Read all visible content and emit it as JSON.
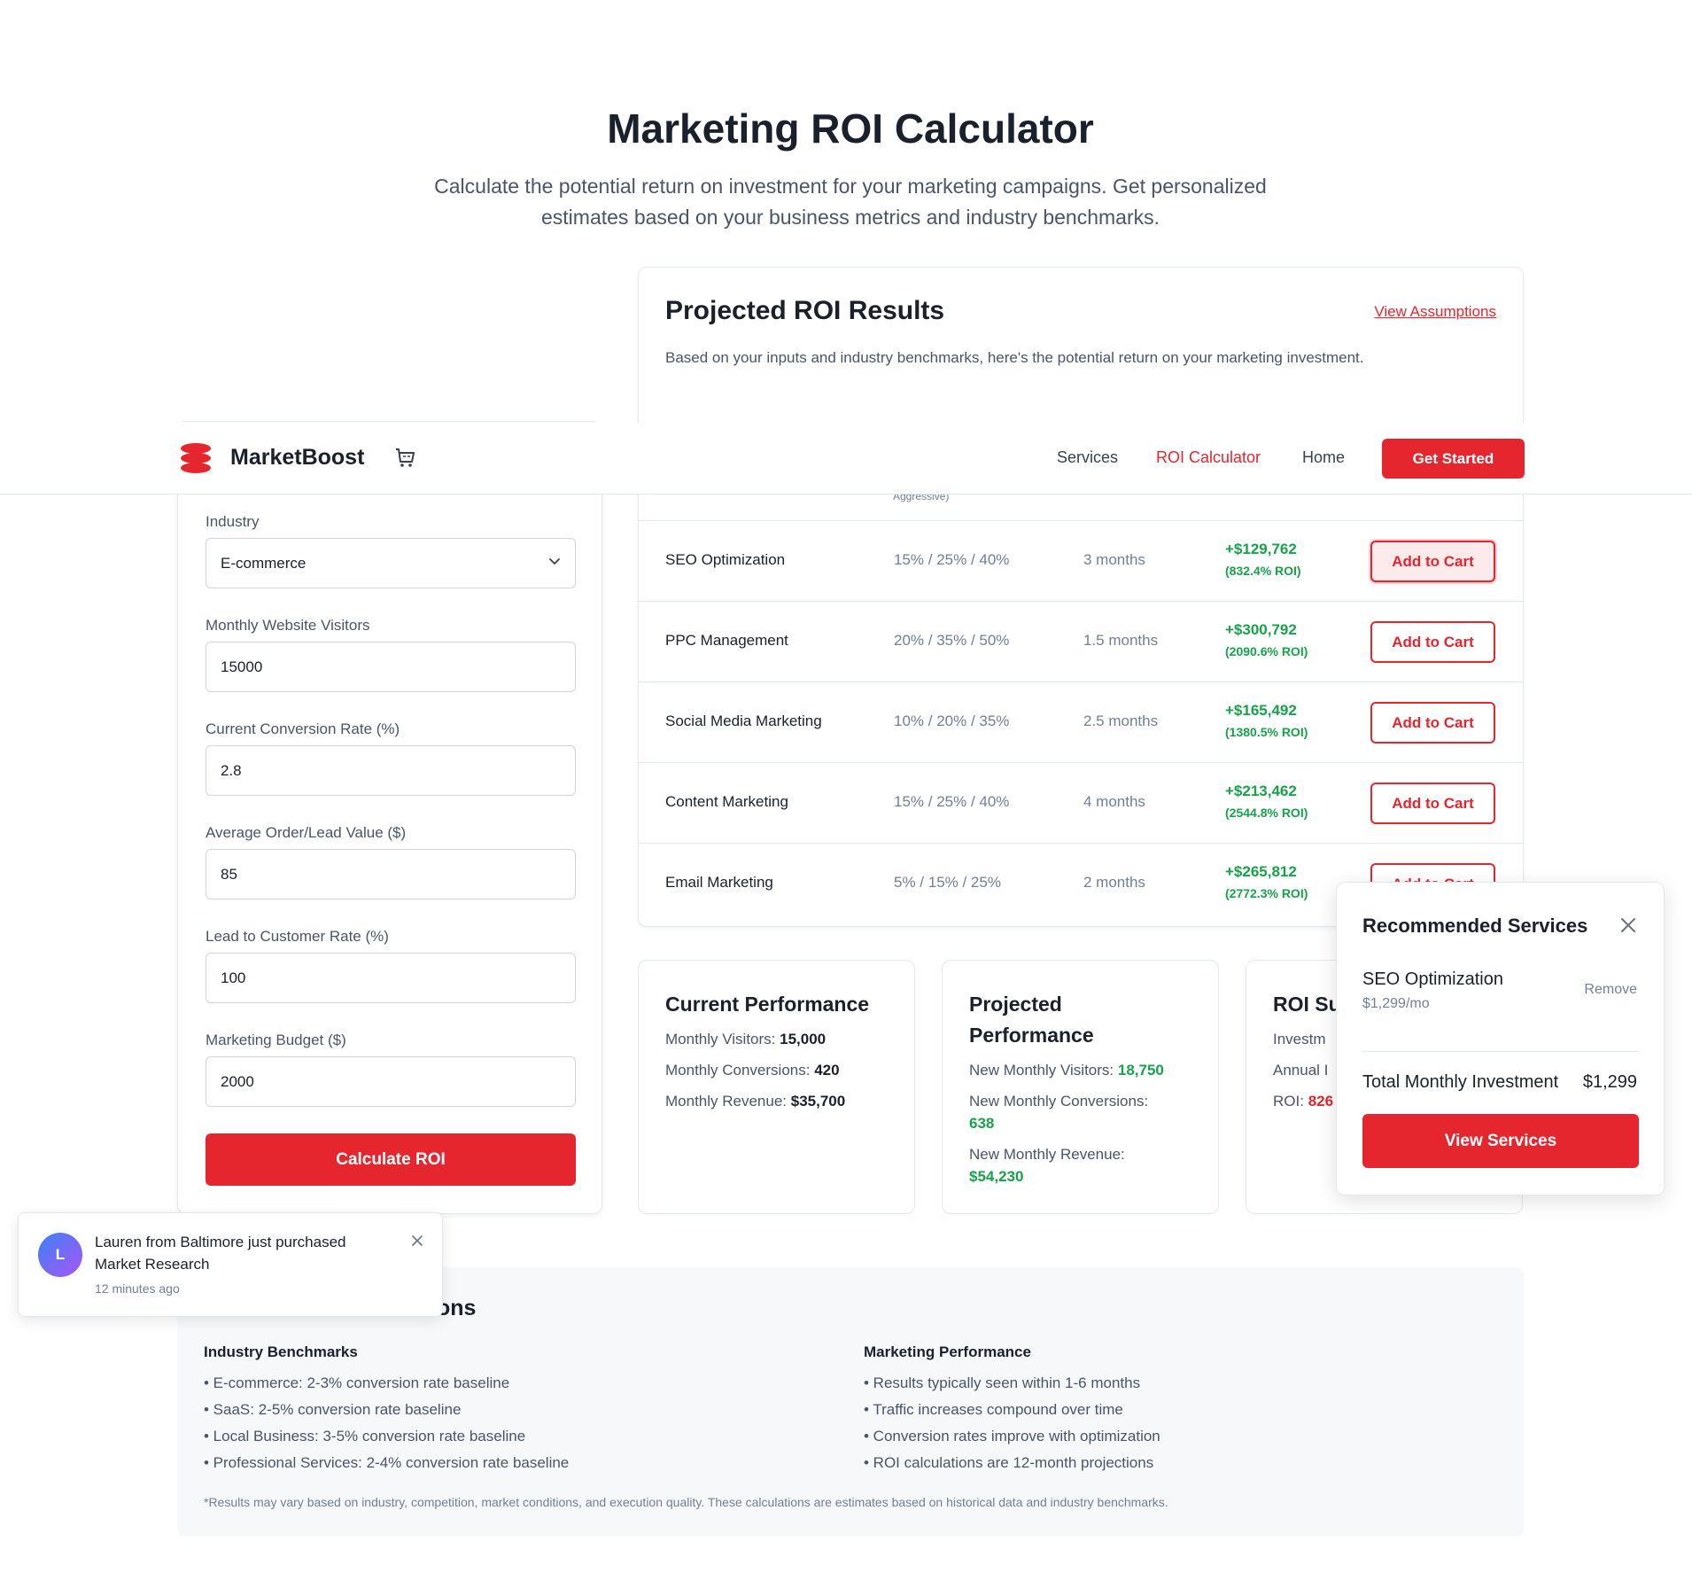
{
  "hero": {
    "title": "Marketing ROI Calculator",
    "subtitle": "Calculate the potential return on investment for your marketing campaigns. Get personalized estimates based on your business metrics and industry benchmarks."
  },
  "results": {
    "title": "Projected ROI Results",
    "view_assumptions": "View Assumptions",
    "description": "Based on your inputs and industry benchmarks, here's the potential return on your marketing investment.",
    "column_note": "Aggressive)",
    "rows": [
      {
        "name": "SEO Optimization",
        "rates": "15% / 25% / 40%",
        "time": "3 months",
        "gain": "+$129,762",
        "roi": "(832.4% ROI)",
        "button": "Add to Cart"
      },
      {
        "name": "PPC Management",
        "rates": "20% / 35% / 50%",
        "time": "1.5 months",
        "gain": "+$300,792",
        "roi": "(2090.6% ROI)",
        "button": "Add to Cart"
      },
      {
        "name": "Social Media Marketing",
        "rates": "10% / 20% / 35%",
        "time": "2.5 months",
        "gain": "+$165,492",
        "roi": "(1380.5% ROI)",
        "button": "Add to Cart"
      },
      {
        "name": "Content Marketing",
        "rates": "15% / 25% / 40%",
        "time": "4 months",
        "gain": "+$213,462",
        "roi": "(2544.8% ROI)",
        "button": "Add to Cart"
      },
      {
        "name": "Email Marketing",
        "rates": "5% / 15% / 25%",
        "time": "2 months",
        "gain": "+$265,812",
        "roi": "(2772.3% ROI)",
        "button": "Add to Cart"
      }
    ]
  },
  "form": {
    "industry_label": "Industry",
    "industry_value": "E-commerce",
    "visitors_label": "Monthly Website Visitors",
    "visitors_value": "15000",
    "conversion_label": "Current Conversion Rate (%)",
    "conversion_value": "2.8",
    "order_label": "Average Order/Lead Value ($)",
    "order_value": "85",
    "lead_label": "Lead to Customer Rate (%)",
    "lead_value": "100",
    "budget_label": "Marketing Budget ($)",
    "budget_value": "2000",
    "calc_button": "Calculate ROI"
  },
  "nav": {
    "brand": "MarketBoost",
    "links": [
      "Services",
      "ROI Calculator",
      "Home"
    ],
    "cta": "Get Started",
    "brand_color": "#e5262e"
  },
  "current": {
    "title": "Current Performance",
    "visitors_label": "Monthly Visitors:",
    "visitors": "15,000",
    "conversions_label": "Monthly Conversions:",
    "conversions": "420",
    "revenue_label": "Monthly Revenue:",
    "revenue": "$35,700"
  },
  "projected": {
    "title": "Projected Performance",
    "visitors_label": "New Monthly Visitors:",
    "visitors": "18,750",
    "conversions_label": "New Monthly Conversions:",
    "conversions": "638",
    "revenue_label": "New Monthly Revenue:",
    "revenue": "$54,230"
  },
  "summary": {
    "title": "ROI Su",
    "investment_label": "Investm",
    "annual_label": "Annual I",
    "roi_label": "ROI:",
    "roi_value": "826"
  },
  "recommended": {
    "title": "Recommended Services",
    "item": "SEO Optimization",
    "price": "$1,299/mo",
    "remove": "Remove",
    "total_label": "Total Monthly Investment",
    "total_value": "$1,299",
    "button": "View Services"
  },
  "assumptions": {
    "title": "ons",
    "industry_title": "Industry Benchmarks",
    "industry_items": [
      "• E-commerce: 2-3% conversion rate baseline",
      "• SaaS: 2-5% conversion rate baseline",
      "• Local Business: 3-5% conversion rate baseline",
      "• Professional Services: 2-4% conversion rate baseline"
    ],
    "marketing_title": "Marketing Performance",
    "marketing_items": [
      "• Results typically seen within 1-6 months",
      "• Traffic increases compound over time",
      "• Conversion rates improve with optimization",
      "• ROI calculations are 12-month projections"
    ],
    "note": "*Results may vary based on industry, competition, market conditions, and execution quality. These calculations are estimates based on historical data and industry benchmarks."
  },
  "toast": {
    "avatar": "L",
    "message": "Lauren from Baltimore just purchased Market Research",
    "time": "12 minutes ago"
  }
}
